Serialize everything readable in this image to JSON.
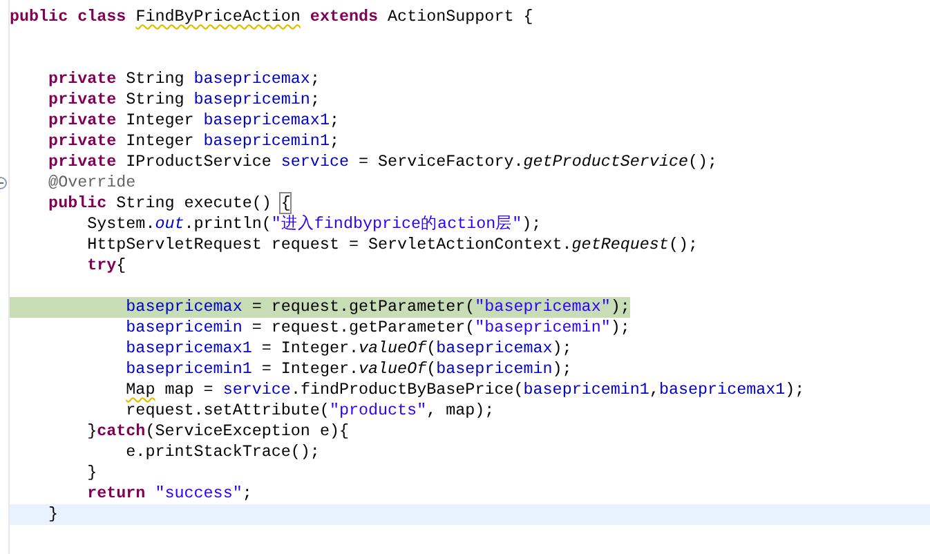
{
  "lines": [
    {
      "tokens": [
        {
          "kind": "keyword",
          "text": "public class "
        },
        {
          "kind": "plain",
          "text": "FindByPriceAction",
          "warning": true
        },
        {
          "kind": "keyword",
          "text": " extends "
        },
        {
          "kind": "plain",
          "text": "ActionSupport {"
        }
      ]
    },
    {
      "kind": "blank"
    },
    {
      "kind": "blank"
    },
    {
      "tokens": [
        {
          "kind": "keyword",
          "text": "    private "
        },
        {
          "kind": "plain",
          "text": "String "
        },
        {
          "kind": "field",
          "text": "basepricemax"
        },
        {
          "kind": "plain",
          "text": ";"
        }
      ]
    },
    {
      "tokens": [
        {
          "kind": "keyword",
          "text": "    private "
        },
        {
          "kind": "plain",
          "text": "String "
        },
        {
          "kind": "field",
          "text": "basepricemin"
        },
        {
          "kind": "plain",
          "text": ";"
        }
      ]
    },
    {
      "tokens": [
        {
          "kind": "keyword",
          "text": "    private "
        },
        {
          "kind": "plain",
          "text": "Integer "
        },
        {
          "kind": "field",
          "text": "basepricemax1"
        },
        {
          "kind": "plain",
          "text": ";"
        }
      ]
    },
    {
      "tokens": [
        {
          "kind": "keyword",
          "text": "    private "
        },
        {
          "kind": "plain",
          "text": "Integer "
        },
        {
          "kind": "field",
          "text": "basepricemin1"
        },
        {
          "kind": "plain",
          "text": ";"
        }
      ]
    },
    {
      "tokens": [
        {
          "kind": "keyword",
          "text": "    private "
        },
        {
          "kind": "plain",
          "text": "IProductService "
        },
        {
          "kind": "field",
          "text": "service"
        },
        {
          "kind": "plain",
          "text": " = ServiceFactory."
        },
        {
          "kind": "static-method",
          "text": "getProductService"
        },
        {
          "kind": "plain",
          "text": "();"
        }
      ]
    },
    {
      "foldable": true,
      "tokens": [
        {
          "kind": "annotation",
          "text": "    @Override"
        }
      ]
    },
    {
      "tokens": [
        {
          "kind": "keyword",
          "text": "    public "
        },
        {
          "kind": "plain",
          "text": "String execute() "
        },
        {
          "kind": "plain",
          "text": "{",
          "matched": true
        }
      ]
    },
    {
      "tokens": [
        {
          "kind": "plain",
          "text": "        System."
        },
        {
          "kind": "static-field",
          "text": "out"
        },
        {
          "kind": "plain",
          "text": ".println("
        },
        {
          "kind": "string",
          "text": "\"进入findbyprice的action层\""
        },
        {
          "kind": "plain",
          "text": ");"
        }
      ]
    },
    {
      "tokens": [
        {
          "kind": "plain",
          "text": "        HttpServletRequest request = ServletActionContext."
        },
        {
          "kind": "static-method",
          "text": "getRequest"
        },
        {
          "kind": "plain",
          "text": "();"
        }
      ]
    },
    {
      "tokens": [
        {
          "kind": "keyword",
          "text": "        try"
        },
        {
          "kind": "plain",
          "text": "{"
        }
      ]
    },
    {
      "kind": "blank"
    },
    {
      "debug_highlight": true,
      "tokens": [
        {
          "kind": "field",
          "text": "            basepricemax"
        },
        {
          "kind": "plain",
          "text": " = request.getParameter("
        },
        {
          "kind": "string",
          "text": "\"basepricemax\""
        },
        {
          "kind": "plain",
          "text": ");"
        }
      ]
    },
    {
      "tokens": [
        {
          "kind": "field",
          "text": "            basepricemin"
        },
        {
          "kind": "plain",
          "text": " = request.getParameter("
        },
        {
          "kind": "string",
          "text": "\"basepricemin\""
        },
        {
          "kind": "plain",
          "text": ");"
        }
      ]
    },
    {
      "tokens": [
        {
          "kind": "field",
          "text": "            basepricemax1"
        },
        {
          "kind": "plain",
          "text": " = Integer."
        },
        {
          "kind": "static-method",
          "text": "valueOf"
        },
        {
          "kind": "plain",
          "text": "("
        },
        {
          "kind": "field",
          "text": "basepricemax"
        },
        {
          "kind": "plain",
          "text": ");"
        }
      ]
    },
    {
      "tokens": [
        {
          "kind": "field",
          "text": "            basepricemin1"
        },
        {
          "kind": "plain",
          "text": " = Integer."
        },
        {
          "kind": "static-method",
          "text": "valueOf"
        },
        {
          "kind": "plain",
          "text": "("
        },
        {
          "kind": "field",
          "text": "basepricemin"
        },
        {
          "kind": "plain",
          "text": ");"
        }
      ]
    },
    {
      "tokens": [
        {
          "kind": "plain",
          "text": "            Map",
          "warning": true
        },
        {
          "kind": "plain",
          "text": " map = "
        },
        {
          "kind": "field",
          "text": "service"
        },
        {
          "kind": "plain",
          "text": ".findProductByBasePrice("
        },
        {
          "kind": "field",
          "text": "basepricemin1"
        },
        {
          "kind": "plain",
          "text": ","
        },
        {
          "kind": "field",
          "text": "basepricemax1"
        },
        {
          "kind": "plain",
          "text": ");"
        }
      ]
    },
    {
      "tokens": [
        {
          "kind": "plain",
          "text": "            request.setAttribute("
        },
        {
          "kind": "string",
          "text": "\"products\""
        },
        {
          "kind": "plain",
          "text": ", map);"
        }
      ]
    },
    {
      "tokens": [
        {
          "kind": "plain",
          "text": "        }"
        },
        {
          "kind": "keyword",
          "text": "catch"
        },
        {
          "kind": "plain",
          "text": "(ServiceException e){"
        }
      ]
    },
    {
      "tokens": [
        {
          "kind": "plain",
          "text": "            e.printStackTrace();"
        }
      ]
    },
    {
      "tokens": [
        {
          "kind": "plain",
          "text": "        }"
        }
      ]
    },
    {
      "tokens": [
        {
          "kind": "keyword",
          "text": "        return "
        },
        {
          "kind": "string",
          "text": "\"success\""
        },
        {
          "kind": "plain",
          "text": ";"
        }
      ]
    },
    {
      "current_line": true,
      "tokens": [
        {
          "kind": "plain",
          "text": "    }"
        }
      ]
    }
  ]
}
